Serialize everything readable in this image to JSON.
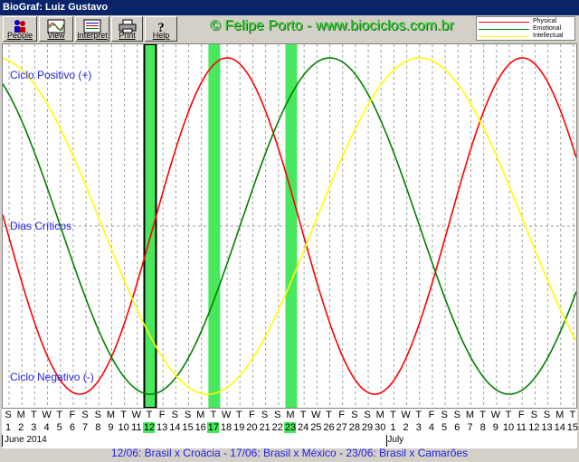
{
  "window": {
    "title": "BioGraf: Luiz Gustavo"
  },
  "toolbar": {
    "buttons": [
      {
        "label": "People",
        "icon": "people-icon"
      },
      {
        "label": "View",
        "icon": "view-chart-icon"
      },
      {
        "label": "Interpret",
        "icon": "interpret-icon"
      },
      {
        "label": "Print",
        "icon": "printer-icon"
      },
      {
        "label": "Help",
        "icon": "help-icon"
      }
    ]
  },
  "credit": "© Felipe Porto - www.biociclos.com.br",
  "legend": {
    "items": [
      {
        "label": "Physical",
        "color": "#ff0000"
      },
      {
        "label": "Emotional",
        "color": "#008000"
      },
      {
        "label": "Intellectual",
        "color": "#ffff00"
      }
    ]
  },
  "chart_labels": {
    "positive": "Ciclo Positivo (+)",
    "critical": "Dias Críticos",
    "negative": "Ciclo Negativo (-)"
  },
  "calendar": {
    "weekdays": [
      "S",
      "M",
      "T",
      "W",
      "T",
      "F",
      "S",
      "S",
      "M",
      "T",
      "W",
      "T",
      "F",
      "S",
      "S",
      "M",
      "T",
      "W",
      "T",
      "F",
      "S",
      "S",
      "M",
      "T",
      "W",
      "T",
      "F",
      "S",
      "S",
      "M",
      "T",
      "W",
      "T",
      "F",
      "S",
      "S",
      "M",
      "T",
      "W",
      "T",
      "F",
      "S",
      "S",
      "M",
      "T",
      "W",
      "T"
    ],
    "days": [
      "1",
      "2",
      "3",
      "4",
      "5",
      "6",
      "7",
      "8",
      "9",
      "10",
      "11",
      "12",
      "13",
      "14",
      "15",
      "16",
      "17",
      "18",
      "19",
      "20",
      "21",
      "22",
      "23",
      "24",
      "25",
      "26",
      "27",
      "28",
      "29",
      "30",
      "1",
      "2",
      "3",
      "4",
      "5",
      "6",
      "7",
      "8",
      "9",
      "10",
      "11",
      "12",
      "13",
      "14",
      "15"
    ],
    "months": [
      {
        "label": "June 2014"
      },
      {
        "label": "July"
      }
    ],
    "highlighted_days": [
      "12",
      "17",
      "23"
    ]
  },
  "status": "12/06: Brasil x Croácia - 17/06: Brasil x México - 23/06: Brasil x Camarões",
  "chart_data": {
    "type": "line",
    "series": [
      {
        "name": "Physical",
        "color": "#ff0000",
        "period_days": 23
      },
      {
        "name": "Emotional",
        "color": "#008000",
        "period_days": 28
      },
      {
        "name": "Intellectual",
        "color": "#ffff00",
        "period_days": 33
      }
    ],
    "x_labels": [
      "Jun 1",
      "Jun 2",
      "Jun 3",
      "Jun 4",
      "Jun 5",
      "Jun 6",
      "Jun 7",
      "Jun 8",
      "Jun 9",
      "Jun 10",
      "Jun 11",
      "Jun 12",
      "Jun 13",
      "Jun 14",
      "Jun 15",
      "Jun 16",
      "Jun 17",
      "Jun 18",
      "Jun 19",
      "Jun 20",
      "Jun 21",
      "Jun 22",
      "Jun 23",
      "Jun 24",
      "Jun 25",
      "Jun 26",
      "Jun 27",
      "Jun 28",
      "Jun 29",
      "Jun 30",
      "Jul 1",
      "Jul 2",
      "Jul 3",
      "Jul 4",
      "Jul 5",
      "Jul 6",
      "Jul 7",
      "Jul 8",
      "Jul 9",
      "Jul 10",
      "Jul 11",
      "Jul 12",
      "Jul 13",
      "Jul 14",
      "Jul 15"
    ],
    "peaks": {
      "Physical": [
        "Jun 18",
        "Jul 10"
      ],
      "Emotional": [
        "Jun 26"
      ],
      "Intellectual": [
        "Jul 3"
      ]
    },
    "troughs": {
      "Physical": [
        "Jun 6",
        "Jun 29"
      ],
      "Emotional": [
        "Jun 12",
        "Jul 10"
      ],
      "Intellectual": [
        "Jun 17"
      ]
    },
    "highlight_days": [
      "Jun 12",
      "Jun 17",
      "Jun 23"
    ],
    "ylim": [
      -1,
      1
    ],
    "grid": true
  }
}
